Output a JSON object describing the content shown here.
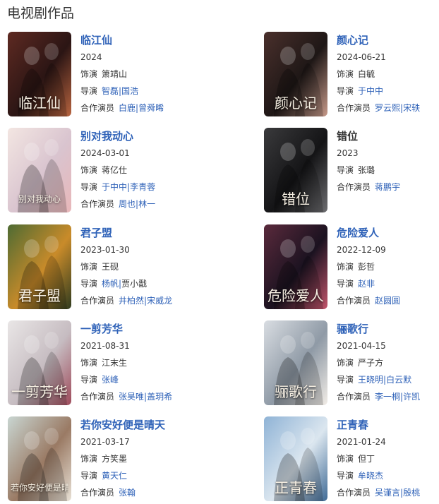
{
  "section_title": "电视剧作品",
  "labels": {
    "role": "饰演",
    "director": "导演",
    "costars": "合作演员"
  },
  "separator": "|",
  "cards": [
    {
      "title": "临江仙",
      "title_linked": true,
      "year": "2024",
      "role": "箫靖山",
      "directors": [
        "智磊",
        "国浩"
      ],
      "costars": [
        "白鹿",
        "曾舜晞"
      ],
      "poster_text": "临江仙",
      "poster_colors": [
        "#5e2a22",
        "#2b1514",
        "#b8643f"
      ]
    },
    {
      "title": "颜心记",
      "title_linked": true,
      "year": "2024-06-21",
      "role": "白毓",
      "directors": [
        "于中中"
      ],
      "costars": [
        "罗云熙",
        "宋轶"
      ],
      "poster_text": "颜心记",
      "poster_colors": [
        "#4a302c",
        "#1e1716",
        "#c79a8a"
      ]
    },
    {
      "title": "别对我动心",
      "title_linked": true,
      "year": "2024-03-01",
      "role": "蒋亿仕",
      "directors": [
        "于中中",
        "李青蓉"
      ],
      "costars": [
        "周也",
        "林一"
      ],
      "poster_text": "别对我动心",
      "poster_colors": [
        "#f3e6e2",
        "#d9c4cf",
        "#e8b7b9"
      ]
    },
    {
      "title": "错位",
      "title_linked": false,
      "year": "2023",
      "role": "",
      "directors_plain": "张璐",
      "costars": [
        "蒋鹏宇"
      ],
      "poster_text": "错位",
      "poster_colors": [
        "#3a3a3c",
        "#141416",
        "#6d6d70"
      ]
    },
    {
      "title": "君子盟",
      "title_linked": true,
      "year": "2023-01-30",
      "role": "王砚",
      "directors": [
        "杨帆"
      ],
      "directors_plain_tail": "贾小戬",
      "costars": [
        "井柏然",
        "宋威龙"
      ],
      "poster_text": "君子盟",
      "poster_colors": [
        "#4e6b33",
        "#c98b2a",
        "#2f3b1f"
      ]
    },
    {
      "title": "危险爱人",
      "title_linked": true,
      "year": "2022-12-09",
      "role": "彭哲",
      "directors": [
        "赵非"
      ],
      "costars": [
        "赵圆圆"
      ],
      "poster_text": "危险爱人",
      "poster_colors": [
        "#5a2a3c",
        "#1b1220",
        "#c2556b"
      ]
    },
    {
      "title": "一剪芳华",
      "title_linked": true,
      "year": "2021-08-31",
      "role": "江末生",
      "directors": [
        "张峰"
      ],
      "costars": [
        "张昊唯",
        "盖玥希"
      ],
      "poster_text": "一剪芳华",
      "poster_colors": [
        "#e9e6e6",
        "#c6bcc1",
        "#9e4a5a"
      ]
    },
    {
      "title": "骊歌行",
      "title_linked": true,
      "year": "2021-04-15",
      "role": "严子方",
      "directors": [
        "王晓明",
        "白云默"
      ],
      "costars": [
        "李一桐",
        "许凯"
      ],
      "poster_text": "骊歌行",
      "poster_colors": [
        "#d9dde2",
        "#8f9aa6",
        "#f1ece6"
      ]
    },
    {
      "title": "若你安好便是晴天",
      "title_linked": true,
      "year": "2021-03-17",
      "role": "方笑墨",
      "directors": [
        "黄天仁"
      ],
      "costars": [
        "张翰"
      ],
      "poster_text": "若你安好便是晴天",
      "poster_colors": [
        "#c9d6d2",
        "#9a7a64",
        "#e8e1d6"
      ]
    },
    {
      "title": "正青春",
      "title_linked": true,
      "year": "2021-01-24",
      "role": "但丁",
      "directors": [
        "牟晓杰"
      ],
      "costars": [
        "吴谨言",
        "殷桃"
      ],
      "poster_text": "正青春",
      "poster_colors": [
        "#8fb3d6",
        "#dbe6ef",
        "#3f6a95"
      ]
    }
  ]
}
